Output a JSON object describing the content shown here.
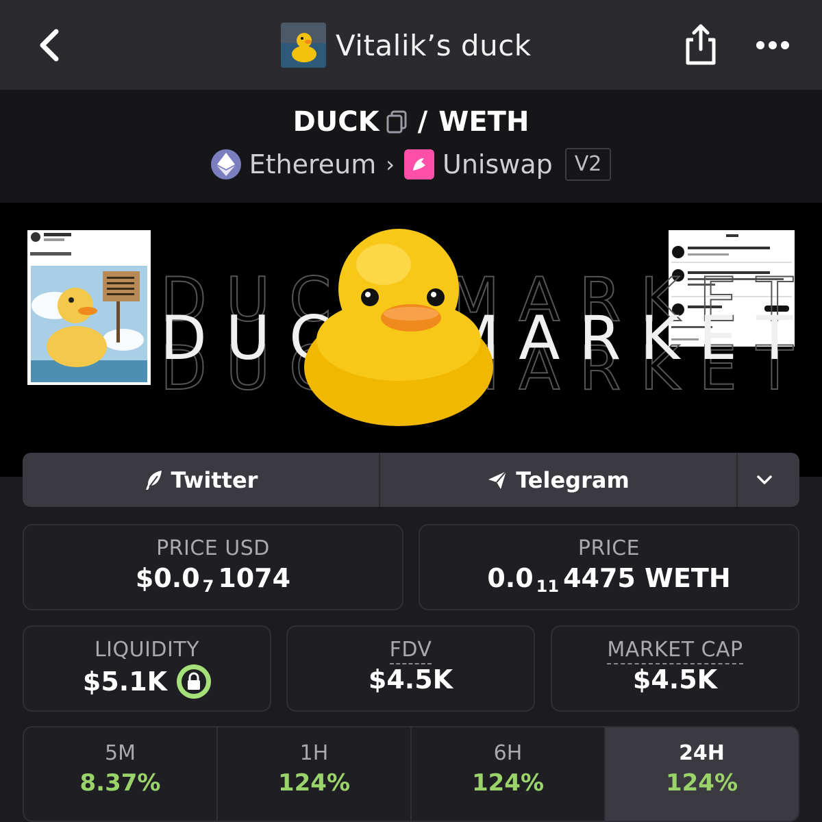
{
  "header": {
    "title": "Vitalik’s duck",
    "back_icon": "chevron-left-icon",
    "share_icon": "share-icon",
    "more_icon": "more-icon"
  },
  "pair": {
    "base": "DUCK",
    "separator": "/",
    "quote": "WETH",
    "chain": "Ethereum",
    "dex": "Uniswap",
    "version": "V2"
  },
  "banner": {
    "text": "DUCK MARKET"
  },
  "social": {
    "twitter_label": "Twitter",
    "telegram_label": "Telegram"
  },
  "stats": {
    "price_usd": {
      "label": "PRICE USD",
      "prefix": "$0.0",
      "zeros": "7",
      "digits": "1074"
    },
    "price": {
      "label": "PRICE",
      "prefix": "0.0",
      "zeros": "11",
      "digits": "4475 WETH"
    },
    "liquidity": {
      "label": "LIQUIDITY",
      "value": "$5.1K"
    },
    "fdv": {
      "label": "FDV",
      "value": "$4.5K"
    },
    "market_cap": {
      "label": "MARKET CAP",
      "value": "$4.5K"
    }
  },
  "timeframes": [
    {
      "label": "5M",
      "value": "8.37%"
    },
    {
      "label": "1H",
      "value": "124%"
    },
    {
      "label": "6H",
      "value": "124%"
    },
    {
      "label": "24H",
      "value": "124%"
    }
  ],
  "colors": {
    "positive": "#9bd36b",
    "lock": "#a6e07a",
    "ethereum": "#7b7fbf",
    "uniswap": "#ff4fa8"
  }
}
